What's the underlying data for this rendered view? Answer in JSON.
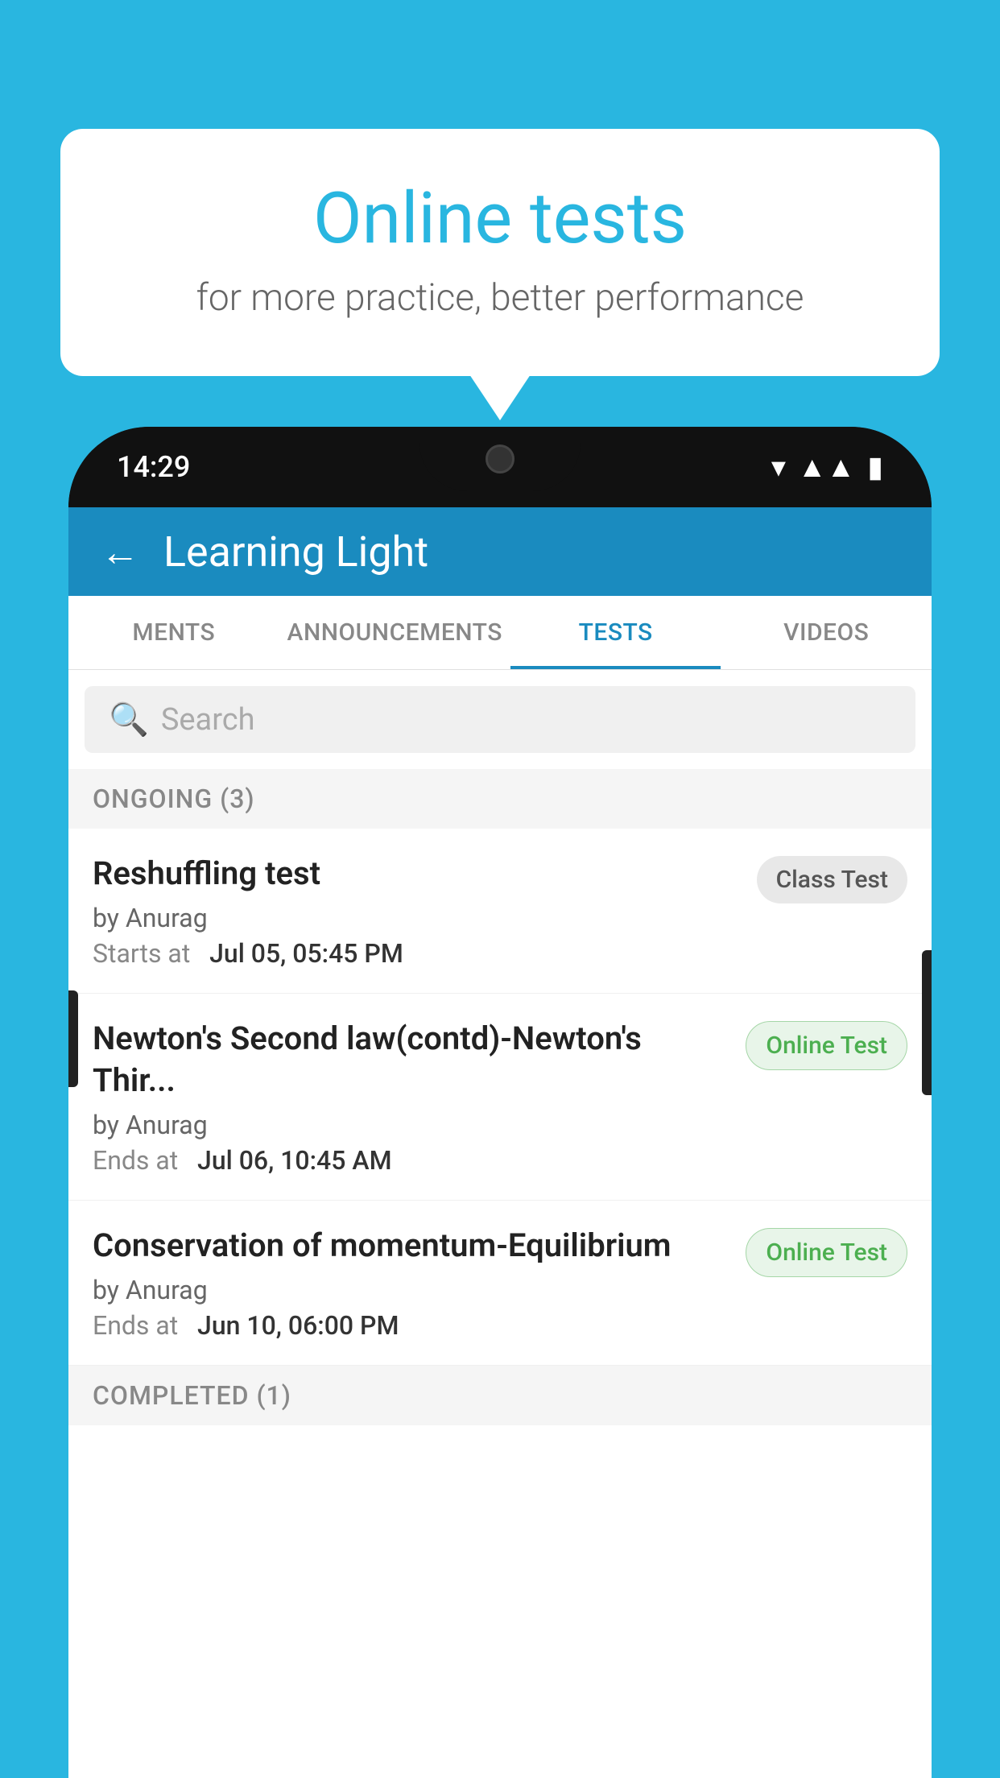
{
  "background_color": "#29b6e0",
  "speech_bubble": {
    "title": "Online tests",
    "subtitle": "for more practice, better performance"
  },
  "phone": {
    "time": "14:29",
    "app_name": "Learning Light",
    "tabs": [
      {
        "id": "ments",
        "label": "MENTS",
        "active": false
      },
      {
        "id": "announcements",
        "label": "ANNOUNCEMENTS",
        "active": false
      },
      {
        "id": "tests",
        "label": "TESTS",
        "active": true
      },
      {
        "id": "videos",
        "label": "VIDEOS",
        "active": false
      }
    ],
    "search": {
      "placeholder": "Search"
    },
    "ongoing_section": "ONGOING (3)",
    "completed_section": "COMPLETED (1)",
    "tests": [
      {
        "id": "test-1",
        "name": "Reshuffling test",
        "author": "by Anurag",
        "date_label": "Starts at",
        "date": "Jul 05, 05:45 PM",
        "badge": "Class Test",
        "badge_type": "class"
      },
      {
        "id": "test-2",
        "name": "Newton's Second law(contd)-Newton's Thir...",
        "author": "by Anurag",
        "date_label": "Ends at",
        "date": "Jul 06, 10:45 AM",
        "badge": "Online Test",
        "badge_type": "online"
      },
      {
        "id": "test-3",
        "name": "Conservation of momentum-Equilibrium",
        "author": "by Anurag",
        "date_label": "Ends at",
        "date": "Jun 10, 06:00 PM",
        "badge": "Online Test",
        "badge_type": "online"
      }
    ]
  }
}
